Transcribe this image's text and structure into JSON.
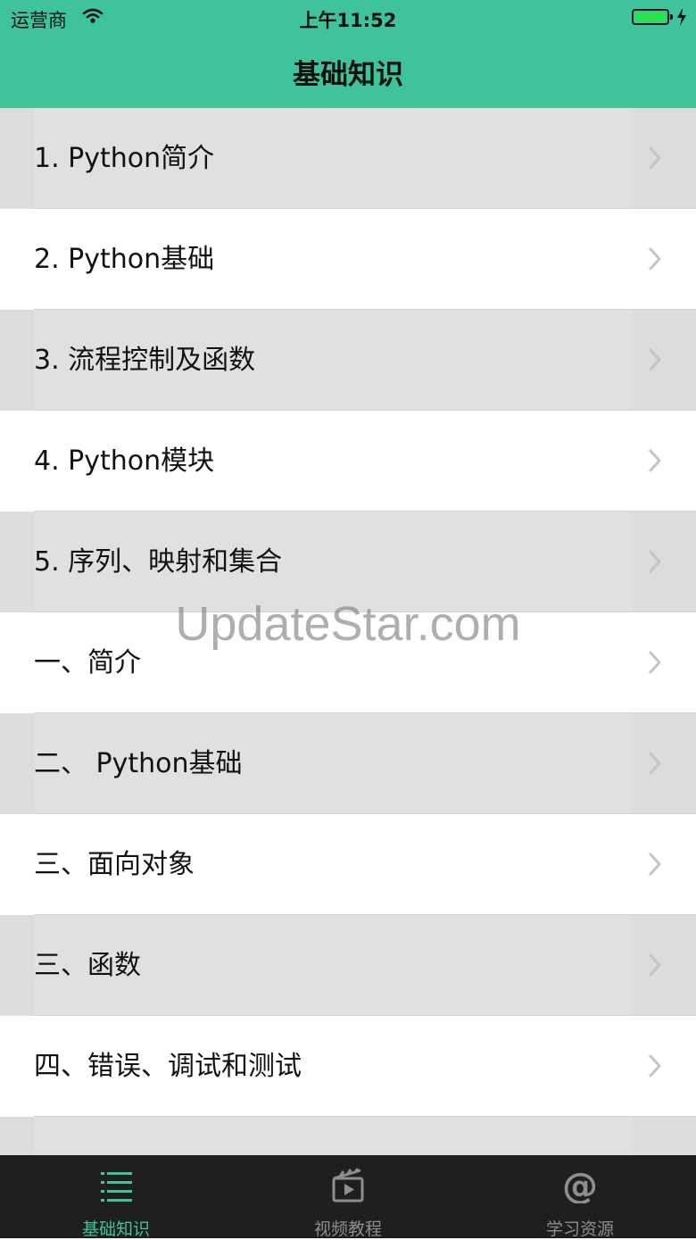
{
  "status_bar": {
    "carrier": "运营商",
    "time": "上午11:52"
  },
  "nav": {
    "title": "基础知识"
  },
  "list": {
    "items": [
      {
        "label": "1. Python简介",
        "shaded": true
      },
      {
        "label": "2. Python基础",
        "shaded": false
      },
      {
        "label": "3. 流程控制及函数",
        "shaded": true
      },
      {
        "label": "4. Python模块",
        "shaded": false
      },
      {
        "label": "5. 序列、映射和集合",
        "shaded": true
      },
      {
        "label": "一、简介",
        "shaded": false
      },
      {
        "label": "二、 Python基础",
        "shaded": true
      },
      {
        "label": "三、面向对象",
        "shaded": false
      },
      {
        "label": "三、函数",
        "shaded": true
      },
      {
        "label": "四、错误、调试和测试",
        "shaded": false
      }
    ]
  },
  "watermark": "UpdateStar.com",
  "tabbar": {
    "tabs": [
      {
        "label": "基础知识",
        "icon": "list-icon",
        "active": true
      },
      {
        "label": "视频教程",
        "icon": "clapperboard-icon",
        "active": false
      },
      {
        "label": "学习资源",
        "icon": "at-sign-icon",
        "active": false
      }
    ]
  },
  "colors": {
    "header": "#3ec39a",
    "active_tab": "#3ec39a",
    "tabbar_bg": "#1f1f1f",
    "row_shaded": "#dcdcdc"
  }
}
